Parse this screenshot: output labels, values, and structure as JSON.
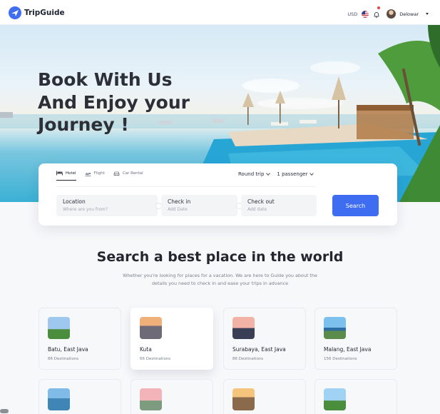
{
  "nav": {
    "brand": "TripGuide",
    "currency": "USD",
    "username": "Delowar"
  },
  "hero": {
    "title_lines": [
      "Book With Us",
      "And Enjoy your",
      "Journey !"
    ]
  },
  "search": {
    "tabs": [
      {
        "label": "Hotel",
        "icon": "bed-icon",
        "active": true
      },
      {
        "label": "Flight",
        "icon": "plane-icon",
        "active": false
      },
      {
        "label": "Car Rental",
        "icon": "car-icon",
        "active": false
      }
    ],
    "trip_type": "Round trip",
    "passengers": "1 passenger",
    "fields": {
      "location": {
        "label": "Location",
        "placeholder": "Where are you from?"
      },
      "check_in": {
        "label": "Check in",
        "placeholder": "Add Date"
      },
      "check_out": {
        "label": "Check out",
        "placeholder": "Add date"
      }
    },
    "button": "Search"
  },
  "section": {
    "title": "Search a best place in the world",
    "subtitle": "Whether you're looking for places for a vacation. We are here to Guide you about the details you need to check in and ease your trips in advance"
  },
  "destinations": [
    {
      "name": "Batu, East Java",
      "count": "86 Destinations"
    },
    {
      "name": "Kuta",
      "count": "66 Destinations"
    },
    {
      "name": "Surabaya, East Java",
      "count": "86 Destinations"
    },
    {
      "name": "Malang, East Java",
      "count": "156 Destinations"
    }
  ],
  "colors": {
    "accent": "#3e6df2",
    "text": "#1f2430",
    "muted": "#7a808c",
    "notification_dot": "#f04343"
  }
}
